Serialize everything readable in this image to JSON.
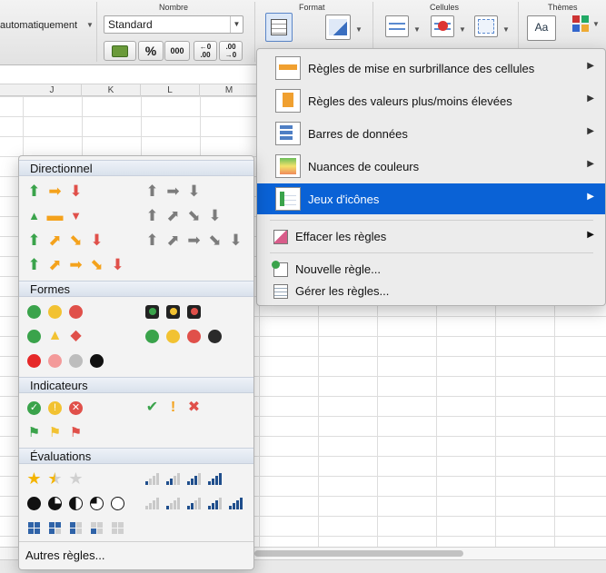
{
  "ribbon": {
    "groups": {
      "number": "Nombre",
      "format": "Format",
      "cells": "Cellules",
      "themes": "Thèmes"
    },
    "alignment_text": "automatiquement",
    "number_format": "Standard",
    "percent_label": "%",
    "thousands_label": "000",
    "decimal_inc_label": "←0\n.00",
    "decimal_dec_label": ".00\n→0"
  },
  "columns": [
    "J",
    "K",
    "L",
    "M"
  ],
  "main_menu": {
    "items": [
      {
        "label": "Règles de mise en surbrillance des cellules",
        "has_submenu": true
      },
      {
        "label": "Règles des valeurs plus/moins élevées",
        "has_submenu": true
      },
      {
        "label": "Barres de données",
        "has_submenu": true
      },
      {
        "label": "Nuances de couleurs",
        "has_submenu": true
      },
      {
        "label": "Jeux d'icônes",
        "has_submenu": true,
        "selected": true
      },
      {
        "label": "Effacer les règles",
        "has_submenu": true
      },
      {
        "label": "Nouvelle règle...",
        "has_submenu": false
      },
      {
        "label": "Gérer les règles...",
        "has_submenu": false
      }
    ],
    "submenu_arrow": "▶"
  },
  "icon_sets": {
    "sections": [
      "Directionnel",
      "Formes",
      "Indicateurs",
      "Évaluations"
    ],
    "more_rules": "Autres règles...",
    "colors": {
      "green": "#3aa34b",
      "yellow": "#f2c232",
      "red": "#e0504a",
      "orange": "#f4a21c",
      "gray": "#7c7c7c",
      "blue": "#1f4e8c"
    }
  },
  "colors": {
    "selection": "#0a62d6"
  }
}
